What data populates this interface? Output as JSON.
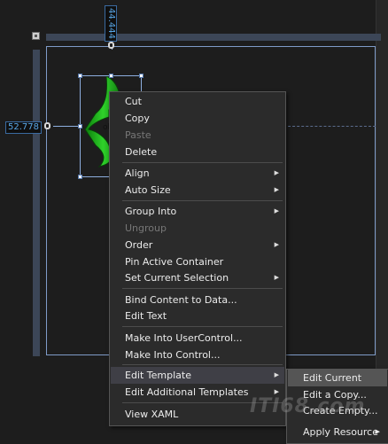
{
  "design_surface": {
    "height_readout": "44.444",
    "width_readout": "52.778"
  },
  "context_menu": {
    "items": [
      {
        "label": "Cut",
        "enabled": true
      },
      {
        "label": "Copy",
        "enabled": true
      },
      {
        "label": "Paste",
        "enabled": false
      },
      {
        "label": "Delete",
        "enabled": true
      },
      {
        "label": "Align",
        "enabled": true,
        "submenu": true
      },
      {
        "label": "Auto Size",
        "enabled": true,
        "submenu": true
      },
      {
        "label": "Group Into",
        "enabled": true,
        "submenu": true
      },
      {
        "label": "Ungroup",
        "enabled": false
      },
      {
        "label": "Order",
        "enabled": true,
        "submenu": true
      },
      {
        "label": "Pin Active Container",
        "enabled": true
      },
      {
        "label": "Set Current Selection",
        "enabled": true,
        "submenu": true
      },
      {
        "label": "Bind Content to Data...",
        "enabled": true
      },
      {
        "label": "Edit Text",
        "enabled": true
      },
      {
        "label": "Make Into UserControl...",
        "enabled": true
      },
      {
        "label": "Make Into Control...",
        "enabled": true
      },
      {
        "label": "Edit Template",
        "enabled": true,
        "submenu": true,
        "highlighted": true
      },
      {
        "label": "Edit Additional Templates",
        "enabled": true,
        "submenu": true
      },
      {
        "label": "View XAML",
        "enabled": true
      }
    ]
  },
  "submenu": {
    "items": [
      {
        "label": "Edit Current",
        "highlighted": true
      },
      {
        "label": "Edit a Copy..."
      },
      {
        "label": "Create Empty..."
      },
      {
        "label": "Apply Resource",
        "submenu": true
      }
    ]
  },
  "icons": {
    "arrow": "▶",
    "corner": "ruler-corner-icon",
    "lock": "lock-icon"
  },
  "colors": {
    "highlight": "#3f3f46",
    "shape_fill": "#22c51e",
    "selection": "#8eaedf"
  },
  "watermark": "ITI68.com"
}
